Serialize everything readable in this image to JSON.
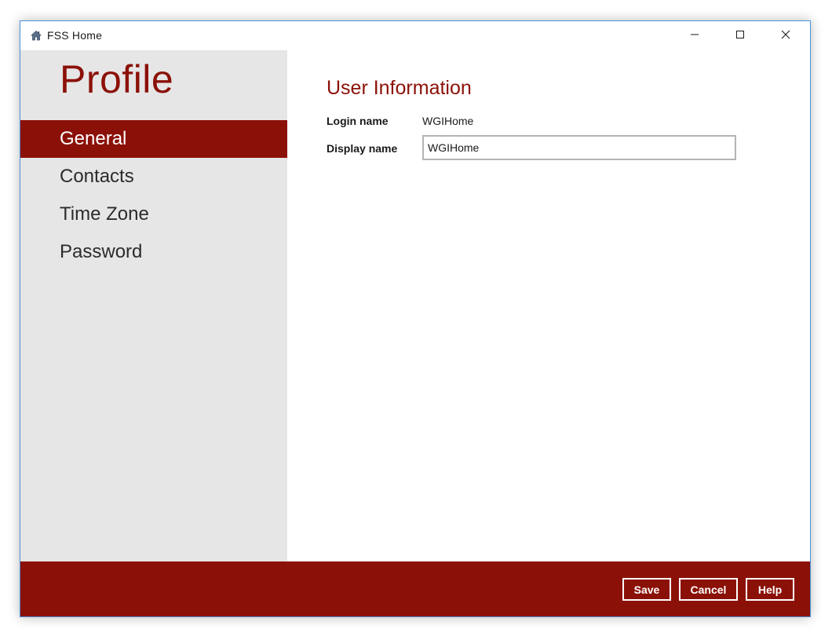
{
  "window": {
    "title": "FSS Home",
    "icon": "house-icon"
  },
  "controls": {
    "minimize_icon": "minimize-icon",
    "maximize_icon": "maximize-icon",
    "close_icon": "close-icon"
  },
  "sidebar": {
    "heading": "Profile",
    "items": [
      {
        "label": "General",
        "active": true
      },
      {
        "label": "Contacts",
        "active": false
      },
      {
        "label": "Time Zone",
        "active": false
      },
      {
        "label": "Password",
        "active": false
      }
    ]
  },
  "main": {
    "section_title": "User Information",
    "login_name_label": "Login name",
    "login_name_value": "WGIHome",
    "display_name_label": "Display name",
    "display_name_value": "WGIHome"
  },
  "footer": {
    "save_label": "Save",
    "cancel_label": "Cancel",
    "help_label": "Help"
  },
  "colors": {
    "accent": "#8b1108",
    "sidebar_bg": "#e6e6e6",
    "window_border": "#4a90d9"
  }
}
